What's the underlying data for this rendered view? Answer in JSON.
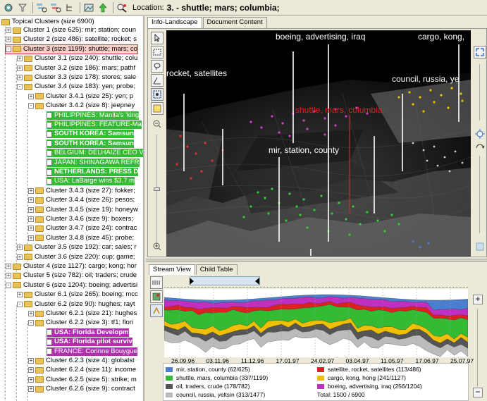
{
  "toolbar": {
    "location_label": "Location:",
    "location_value": "3. - shuttle; mars; columbia;"
  },
  "tree": {
    "root": "Topical Clusters (size 6900)",
    "rows": [
      "Cluster 1 (size 625): mir; station; coun",
      "Cluster 2 (size 486): satellite; rocket; s",
      "Cluster 3 (size 1199): shuttle; mars; co",
      "Cluster 3.1 (size 240): shuttle; colu",
      "Cluster 3.2 (size 186): mars; pathf",
      "Cluster 3.3 (size 178): stores; sale",
      "Cluster 3.4 (size 183): yen; probe;",
      "Cluster 3.4.1 (size 25): yen; p",
      "Cluster 3.4.2 (size 8): jeepney",
      "PHILIPPINES: Manila's 'king",
      "PHILIPPINES: FEATURE-Ma",
      "SOUTH KOREA: Samsun",
      "SOUTH KOREA: Samsun",
      "BELGIUM: DELHAIZE CEO V",
      "JAPAN: SHINAGAWA REFR",
      "NETHERLANDS: PRESS D",
      "USA: LaBarge wins $3.7 m",
      "Cluster 3.4.3 (size 27): fokker;",
      "Cluster 3.4.4 (size 26): pesos;",
      "Cluster 3.4.5 (size 19): honeyw",
      "Cluster 3.4.6 (size 9): boxers;",
      "Cluster 3.4.7 (size 24): contrac",
      "Cluster 3.4.8 (size 45): probe;",
      "Cluster 3.5 (size 192): car; sales; r",
      "Cluster 3.6 (size 220): cup; game;",
      "Cluster 4 (size 1127): cargo; kong; hor",
      "Cluster 5 (size 782): oil; traders; crude",
      "Cluster 6 (size 1204): boeing; advertisi",
      "Cluster 6.1 (size 265): boeing; mcc",
      "Cluster 6.2 (size 90): hughes; rayt",
      "Cluster 6.2.1 (size 21): hughes",
      "Cluster 6.2.2 (size 3): tf1; flori",
      "USA: Florida Developm",
      "USA: Florida pilot surviv",
      "FRANCE: Corinne Bouygue",
      "Cluster 6.2.3 (size 4): globalst",
      "Cluster 6.2.4 (size 11): income",
      "Cluster 6.2.5 (size 5): strike; m",
      "Cluster 6.2.6 (size 9): contract"
    ]
  },
  "tabs_top": [
    "Info-Landscape",
    "Document Content"
  ],
  "landscape_labels": {
    "boeing": "boeing, advertising, iraq",
    "cargo": "cargo, kong,",
    "rocket": "rocket, satellites",
    "council": "council, russia, ye",
    "shuttle": "shuttle, mars, columbia",
    "mir": "mir, station, county"
  },
  "tabs_bottom": [
    "Stream View",
    "Child Table"
  ],
  "axis_ticks": [
    "26.09.96",
    "03.11.96",
    "11.12.96",
    "17.01.97",
    "24.02.97",
    "03.04.97",
    "11.05.97",
    "17.06.97",
    "25.07.97"
  ],
  "legend": {
    "items": [
      {
        "label": "mir, station, county (62/625)",
        "color": "#4a7fd0"
      },
      {
        "label": "satellite, rocket, satellites (113/486)",
        "color": "#e02020"
      },
      {
        "label": "shuttle, mars, columbia (337/1199)",
        "color": "#33bb33"
      },
      {
        "label": "cargo, kong, hong (241/1127)",
        "color": "#f0c000"
      },
      {
        "label": "oil, traders, crude (178/782)",
        "color": "#555555"
      },
      {
        "label": "boeing, advertising, iraq (256/1204)",
        "color": "#c030c0"
      },
      {
        "label": "council, russia, yeltsin (313/1477)",
        "color": "#bbbbbb"
      }
    ],
    "total": "Total: 1500 / 6900"
  },
  "colors": {
    "mir": "#4a7fd0",
    "satellite": "#e02020",
    "shuttle": "#33bb33",
    "cargo": "#f0c000",
    "oil": "#555555",
    "boeing": "#c030c0",
    "council": "#bbbbbb"
  }
}
